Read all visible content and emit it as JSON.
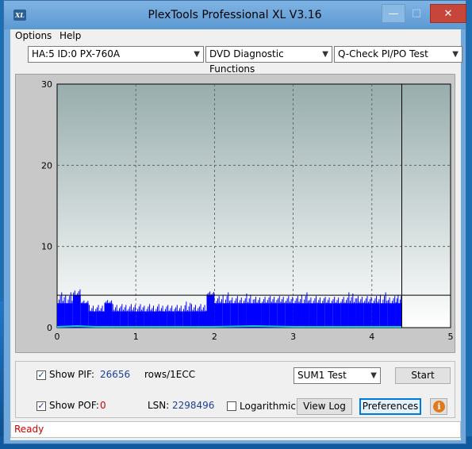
{
  "window": {
    "title": "PlexTools Professional XL V3.16",
    "icon_text": "XL"
  },
  "menu": {
    "options_label": "Options",
    "help_label": "Help"
  },
  "toolbar": {
    "drive_select": "HA:5 ID:0  PX-760A",
    "function_select": "DVD Diagnostic Functions",
    "test_select": "Q-Check PI/PO Test"
  },
  "chart_data": {
    "type": "bar",
    "title": "",
    "xlabel": "",
    "ylabel": "",
    "xlim": [
      0,
      5
    ],
    "ylim": [
      0,
      30
    ],
    "x_ticks": [
      "0",
      "1",
      "2",
      "3",
      "4",
      "5"
    ],
    "y_ticks": [
      "0",
      "10",
      "20",
      "30"
    ],
    "grid": true,
    "threshold_line": 4,
    "end_marker_x": 4.38,
    "series": [
      {
        "color": "#0000ff",
        "x": [
          0.0,
          0.1,
          0.2,
          0.3,
          0.4,
          0.5,
          0.6,
          0.7,
          0.8,
          0.9,
          1.0,
          1.1,
          1.2,
          1.3,
          1.4,
          1.5,
          1.6,
          1.7,
          1.8,
          1.9,
          2.0,
          2.1,
          2.2,
          2.3,
          2.4,
          2.5,
          2.6,
          2.7,
          2.8,
          2.9,
          3.0,
          3.1,
          3.2,
          3.3,
          3.4,
          3.5,
          3.6,
          3.7,
          3.8,
          3.9,
          4.0,
          4.1,
          4.2,
          4.3
        ],
        "values": [
          3,
          3,
          4,
          3,
          2,
          2,
          3,
          2,
          2,
          2,
          2,
          2,
          2,
          2,
          2,
          2,
          2,
          2,
          2,
          4,
          3,
          3,
          3,
          3,
          3,
          3,
          3,
          3,
          3,
          3,
          3,
          3,
          3,
          3,
          3,
          3,
          3,
          3,
          3,
          3,
          3,
          3,
          3,
          3
        ],
        "peaks": [
          4.5,
          4.5,
          4.8,
          3.5,
          3.0,
          3.0,
          3.5,
          3.0,
          3.0,
          3.0,
          3.0,
          3.0,
          3.0,
          3.0,
          3.0,
          3.0,
          3.5,
          3.0,
          3.0,
          4.5,
          4.0,
          4.5,
          4.0,
          4.0,
          4.5,
          4.0,
          4.0,
          4.0,
          4.0,
          4.0,
          4.0,
          4.5,
          4.0,
          4.0,
          4.0,
          4.0,
          4.0,
          4.5,
          4.0,
          4.0,
          4.0,
          4.5,
          4.0,
          4.5
        ]
      },
      {
        "color": "#19c8c8",
        "x": [
          0.0,
          0.25,
          0.5,
          1.0,
          1.5,
          2.0,
          2.5,
          3.0,
          3.5,
          4.0,
          4.38
        ],
        "values": [
          0.1,
          0.2,
          0.1,
          0.1,
          0.1,
          0.1,
          0.2,
          0.1,
          0.1,
          0.1,
          0.1
        ]
      }
    ]
  },
  "controls": {
    "show_pif_label": "Show PIF:",
    "pif_value": "26656",
    "rows_label": "rows/1ECC",
    "sum_test_select": "SUM1 Test",
    "start_label": "Start",
    "show_pof_label": "Show POF:",
    "pof_value": "0",
    "lsn_label": "LSN:",
    "lsn_value": "2298496",
    "logarithmic_label": "Logarithmic",
    "view_log_label": "View Log",
    "preferences_label": "Preferences",
    "info_glyph": "i"
  },
  "status": {
    "text": "Ready"
  },
  "colors": {
    "pif_bars": "#0000ff",
    "pof_line": "#19c8c8",
    "accent": "#0078d7",
    "status_text": "#d00000"
  }
}
